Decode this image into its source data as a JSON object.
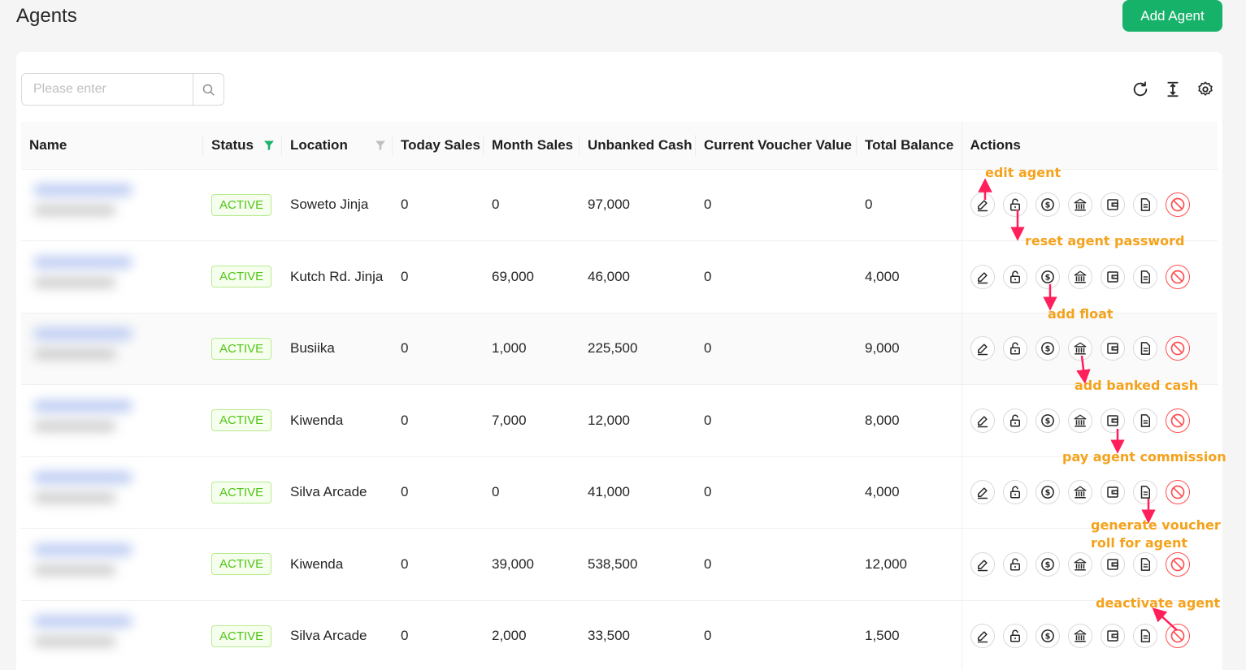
{
  "page": {
    "title": "Agents",
    "add_label": "Add Agent"
  },
  "search": {
    "placeholder": "Please enter",
    "value": ""
  },
  "table": {
    "columns": [
      "Name",
      "Status",
      "Location",
      "Today Sales",
      "Month Sales",
      "Unbanked Cash",
      "Current Voucher Value",
      "Total Balance",
      "Actions"
    ],
    "rows": [
      {
        "status": "ACTIVE",
        "location": "Soweto Jinja",
        "today": "0",
        "month": "0",
        "unbanked": "97,000",
        "voucher": "0",
        "balance": "0"
      },
      {
        "status": "ACTIVE",
        "location": "Kutch Rd. Jinja",
        "today": "0",
        "month": "69,000",
        "unbanked": "46,000",
        "voucher": "0",
        "balance": "4,000"
      },
      {
        "status": "ACTIVE",
        "location": "Busiika",
        "today": "0",
        "month": "1,000",
        "unbanked": "225,500",
        "voucher": "0",
        "balance": "9,000"
      },
      {
        "status": "ACTIVE",
        "location": "Kiwenda",
        "today": "0",
        "month": "7,000",
        "unbanked": "12,000",
        "voucher": "0",
        "balance": "8,000"
      },
      {
        "status": "ACTIVE",
        "location": "Silva Arcade",
        "today": "0",
        "month": "0",
        "unbanked": "41,000",
        "voucher": "0",
        "balance": "4,000"
      },
      {
        "status": "ACTIVE",
        "location": "Kiwenda",
        "today": "0",
        "month": "39,000",
        "unbanked": "538,500",
        "voucher": "0",
        "balance": "12,000"
      },
      {
        "status": "ACTIVE",
        "location": "Silva Arcade",
        "today": "0",
        "month": "2,000",
        "unbanked": "33,500",
        "voucher": "0",
        "balance": "1,500"
      }
    ]
  },
  "annotations": {
    "edit": "edit agent",
    "reset": "reset agent password",
    "float": "add float",
    "banked": "add banked cash",
    "commission": "pay agent commission",
    "voucher_1": "generate voucher",
    "voucher_2": "roll for agent",
    "deactivate": "deactivate agent"
  },
  "colors": {
    "primary": "#17b26a",
    "active_text": "#52c41a",
    "danger": "#ff4d4f",
    "annotation": "#f5a21b",
    "arrow": "#ff1f5a"
  },
  "icons": [
    "search-icon",
    "reload-icon",
    "column-height-icon",
    "settings-icon",
    "filter-icon",
    "edit-icon",
    "unlock-icon",
    "dollar-icon",
    "bank-icon",
    "wallet-icon",
    "file-text-icon",
    "stop-icon"
  ]
}
